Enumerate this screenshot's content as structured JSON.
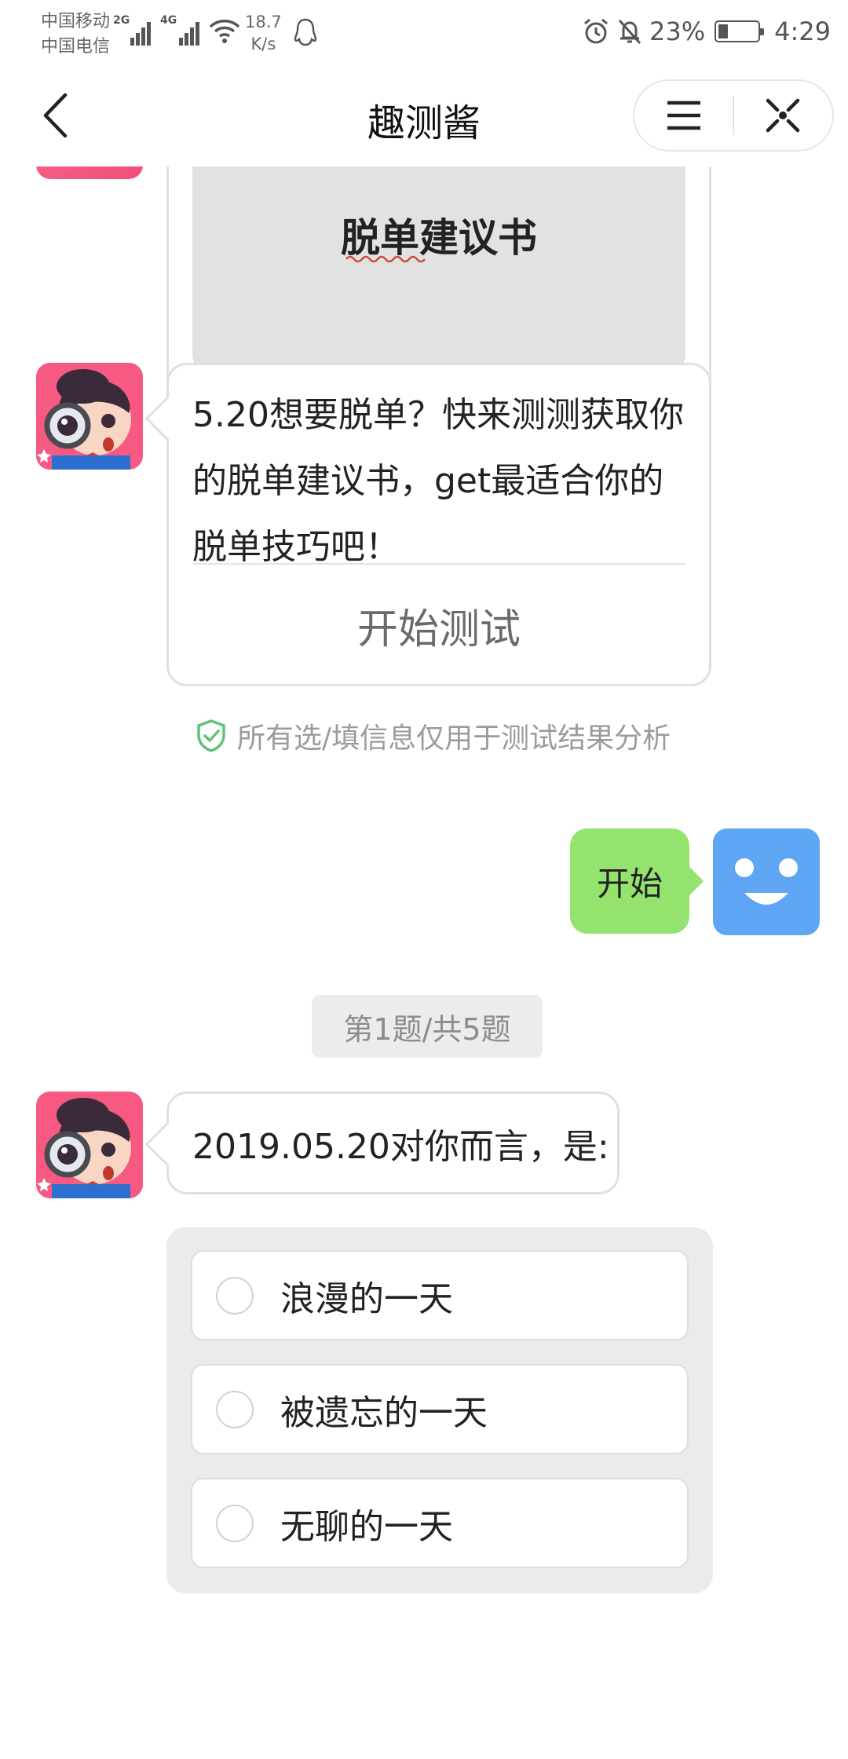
{
  "status_bar": {
    "carrier_1": "中国移动",
    "carrier_2": "中国电信",
    "network_1": "2G",
    "network_2": "4G",
    "speed_value": "18.7",
    "speed_unit": "K/s",
    "battery_percent": "23%",
    "time": "4:29",
    "battery_level": 0.23
  },
  "header": {
    "title": "趣测酱",
    "back_icon": "chevron-left-icon",
    "menu_icon": "menu-icon",
    "close_icon": "close-icon"
  },
  "chat": {
    "book_card": {
      "title": "脱单建议书"
    },
    "intro_card": {
      "text": "5.20想要脱单？快来测测获取你的脱单建议书，get最适合你的脱单技巧吧！",
      "start_button": "开始测试"
    },
    "privacy_note": "所有选/填信息仅用于测试结果分析",
    "user_message": "开始",
    "progress": "第1题/共5题",
    "question": "2019.05.20对你而言，是:",
    "options": [
      {
        "label": "浪漫的一天"
      },
      {
        "label": "被遗忘的一天"
      },
      {
        "label": "无聊的一天"
      }
    ]
  },
  "colors": {
    "user_bubble": "#95e36f",
    "user_avatar": "#5ea5f4",
    "shield": "#5fc37b",
    "card_border": "#e0e0e0",
    "panel_bg": "#ebebeb"
  }
}
